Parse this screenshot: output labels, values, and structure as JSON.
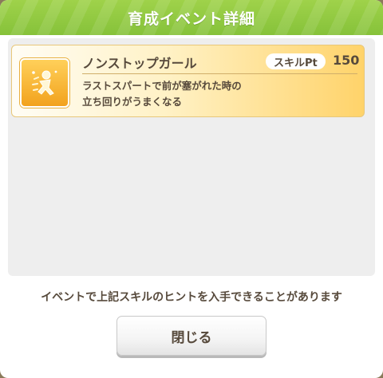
{
  "dialog": {
    "title": "育成イベント詳細",
    "skill": {
      "name": "ノンストップガール",
      "pt_label": "スキルPt",
      "pt_value": "150",
      "description_lines": [
        "ラストスパートで前が塞がれた時の",
        "立ち回りがうまくなる"
      ],
      "icon": "running-figure-icon"
    },
    "hint": "イベントで上記スキルのヒントを入手できることがあります",
    "close_label": "閉じる"
  },
  "colors": {
    "header_green": "#8bc53f",
    "card_gold": "#ffd36a",
    "text_brown": "#574a3c"
  }
}
